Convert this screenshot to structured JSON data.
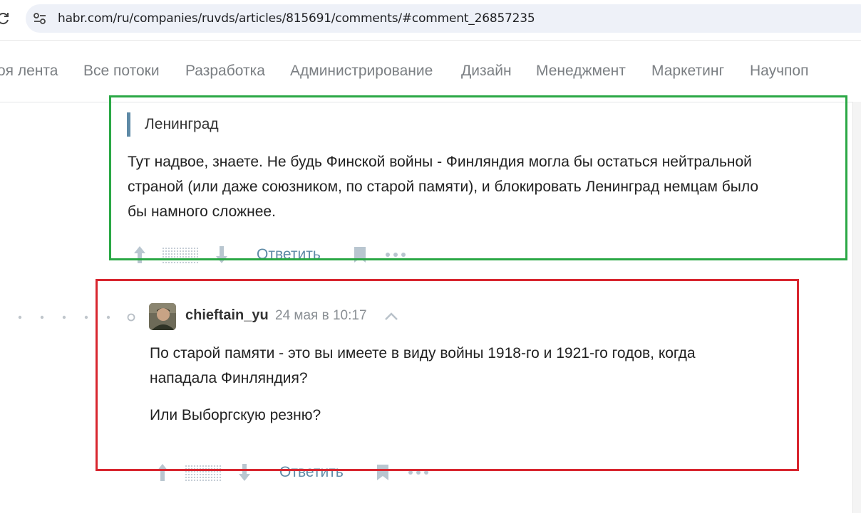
{
  "browser": {
    "url": "habr.com/ru/companies/ruvds/articles/815691/comments/#comment_26857235"
  },
  "nav": {
    "items": [
      "оя лента",
      "Все потоки",
      "Разработка",
      "Администрирование",
      "Дизайн",
      "Менеджмент",
      "Маркетинг",
      "Научпоп"
    ]
  },
  "comment1": {
    "quote": "Ленинград",
    "lines": [
      "Тут надвое, знаете. Не будь Финской войны - Финляндия могла бы остаться нейтральной",
      "страной (или даже союзником, по старой памяти), и блокировать Ленинград немцам было",
      "бы намного сложнее."
    ],
    "reply_label": "Ответить"
  },
  "comment2": {
    "author": "chieftain_yu",
    "timestamp": "24 мая в 10:17",
    "lines": [
      "По старой памяти - это вы имеете в виду войны 1918-го и 1921-го годов, когда",
      "нападала Финляндия?"
    ],
    "line2": "Или Выборгскую резню?",
    "reply_label": "Ответить"
  },
  "colors": {
    "accent": "#5e8aa6",
    "highlight_green": "#2aa845",
    "highlight_red": "#d8262f"
  },
  "icons": [
    "reload-icon",
    "site-settings-icon",
    "vote-up-icon",
    "vote-down-icon",
    "bookmark-icon",
    "more-icon",
    "collapse-icon"
  ]
}
